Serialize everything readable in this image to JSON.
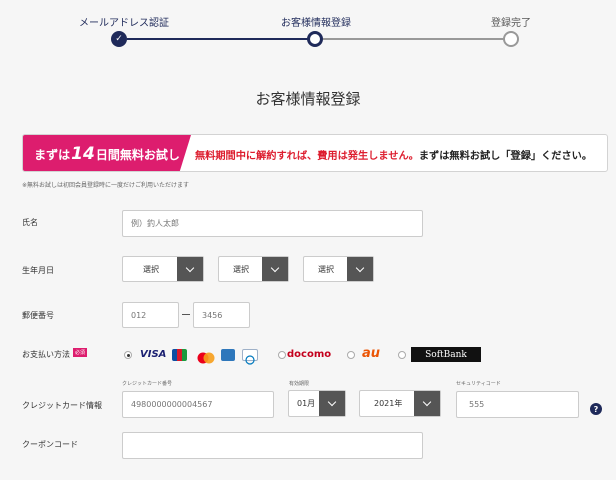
{
  "stepper": {
    "steps": [
      {
        "label": "メールアドレス認証",
        "state": "done"
      },
      {
        "label": "お客様情報登録",
        "state": "current"
      },
      {
        "label": "登録完了",
        "state": "todo"
      }
    ],
    "check": "✓"
  },
  "title": "お客様情報登録",
  "promo": {
    "badge_prefix": "まずは",
    "badge_number": "14",
    "badge_suffix": "日間無料お試し",
    "text_red": "無料期間中に解約すれば、費用は発生しません。",
    "text_dark": "まずは無料お試し「登録」ください。",
    "note": "※無料お試しは初回会員登録時に一度だけご利用いただけます"
  },
  "form": {
    "name": {
      "label": "氏名",
      "placeholder": "例）釣人太郎"
    },
    "birthday": {
      "label": "生年月日",
      "selects": [
        "選択",
        "選択",
        "選択"
      ]
    },
    "postal": {
      "label": "郵便番号",
      "first": "012",
      "second": "3456"
    },
    "payment": {
      "label": "お支払い方法",
      "required": "必須",
      "options": {
        "card_brands": [
          "VISA",
          "JCB",
          "Mastercard",
          "American Express",
          "Diners Club"
        ],
        "docomo": "docomo",
        "au": "au",
        "softbank": "SoftBank"
      },
      "selected": "card"
    },
    "credit": {
      "label": "クレジットカード情報",
      "number_caption": "クレジットカード番号",
      "number_placeholder": "4980000000004567",
      "expiry_caption": "有効期限",
      "month": "01月",
      "year": "2021年",
      "security_caption": "セキュリティコード",
      "security_placeholder": "555",
      "help": "?"
    },
    "coupon": {
      "label": "クーポンコード",
      "placeholder": ""
    }
  },
  "colors": {
    "navy": "#1f2a5a",
    "pink": "#dd1d6e",
    "red": "#dd1d2e",
    "gray_line": "#999999"
  }
}
